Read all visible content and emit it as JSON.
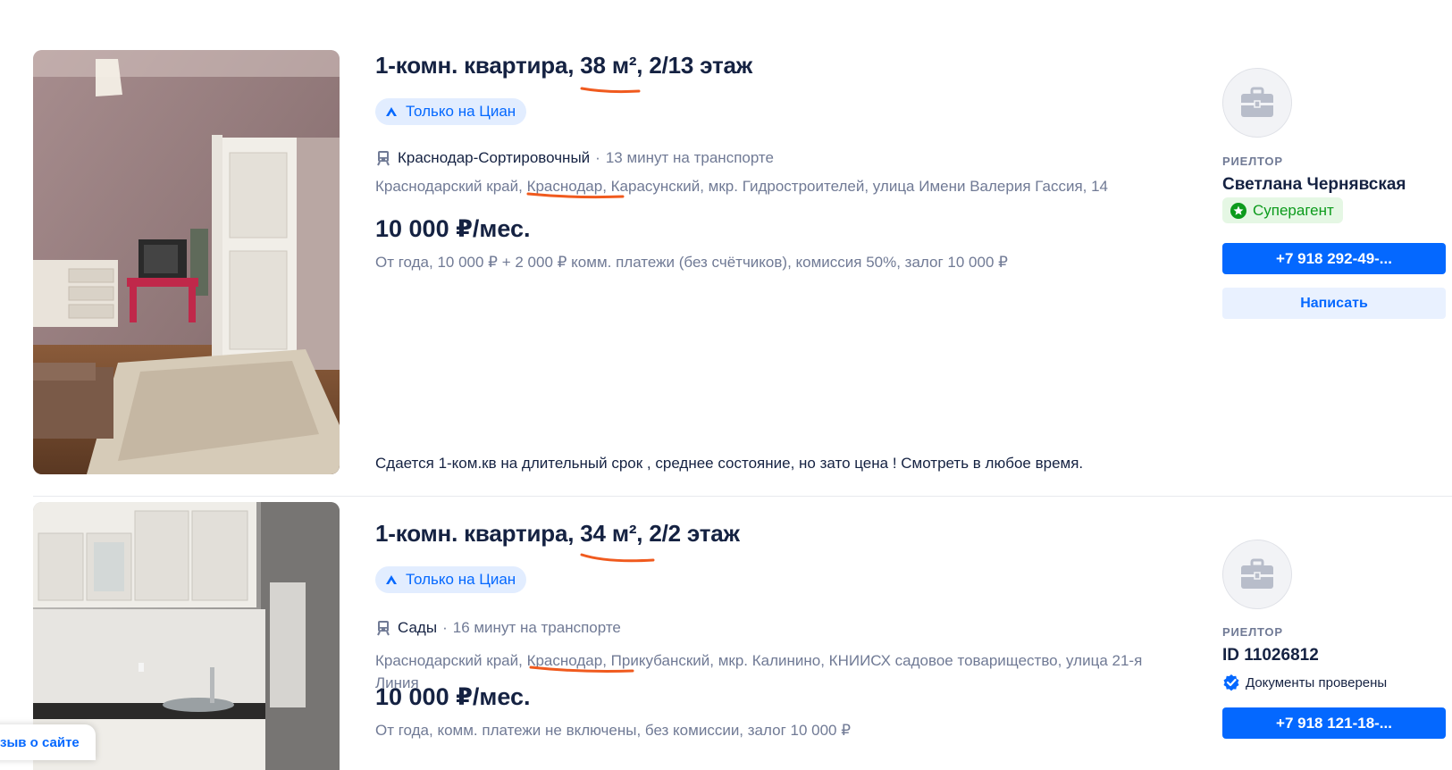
{
  "listings": [
    {
      "title": "1-комн. квартира, 38 м², 2/13 этаж",
      "badge": "Только на Циан",
      "metro_station": "Краснодар-Сортировочный",
      "metro_separator": "·",
      "metro_time": "13 минут на транспорте",
      "address_region": "Краснодарский край,",
      "address_city": "Краснодар,",
      "address_rest": "Карасунский, мкр. Гидростроителей, улица Имени Валерия Гассия, 14",
      "price": "10 000 ₽/мес.",
      "terms": "От года, 10 000 ₽ + 2 000 ₽ комм. платежи (без счётчиков), комиссия 50%, залог 10 000 ₽",
      "description": "Сдается 1-ком.кв на длительный срок , среднее состояние, но зато цена ! Смотреть в любое время.",
      "agent_role": "РИЕЛТОР",
      "agent_name": "Светлана Чернявская",
      "agent_badge": "Суперагент",
      "phone_button": "+7 918 292-49-...",
      "write_button": "Написать"
    },
    {
      "title": "1-комн. квартира, 34 м², 2/2 этаж",
      "badge": "Только на Циан",
      "metro_station": "Сады",
      "metro_separator": "·",
      "metro_time": "16 минут на транспорте",
      "address_region": "Краснодарский край,",
      "address_city": "Краснодар,",
      "address_rest": "Прикубанский, мкр. Калинино, КНИИСХ садовое товарищество, улица 21-я Линия",
      "price": "10 000 ₽/мес.",
      "terms": "От года, комм. платежи не включены, без комиссии, залог 10 000 ₽",
      "agent_role": "РИЕЛТОР",
      "agent_name": "ID 11026812",
      "agent_badge": "Документы проверены",
      "phone_button": "+7 918 121-18-..."
    }
  ],
  "feedback_tab": "зыв о сайте",
  "icons": {
    "badge": "cian-logo-icon",
    "metro": "train-icon",
    "avatar": "briefcase-icon",
    "superagent": "star-badge-icon",
    "verified": "verified-check-icon"
  },
  "colors": {
    "accent": "#0468ff",
    "annotation": "#f05a1e",
    "superagent": "#0c9b1c"
  }
}
